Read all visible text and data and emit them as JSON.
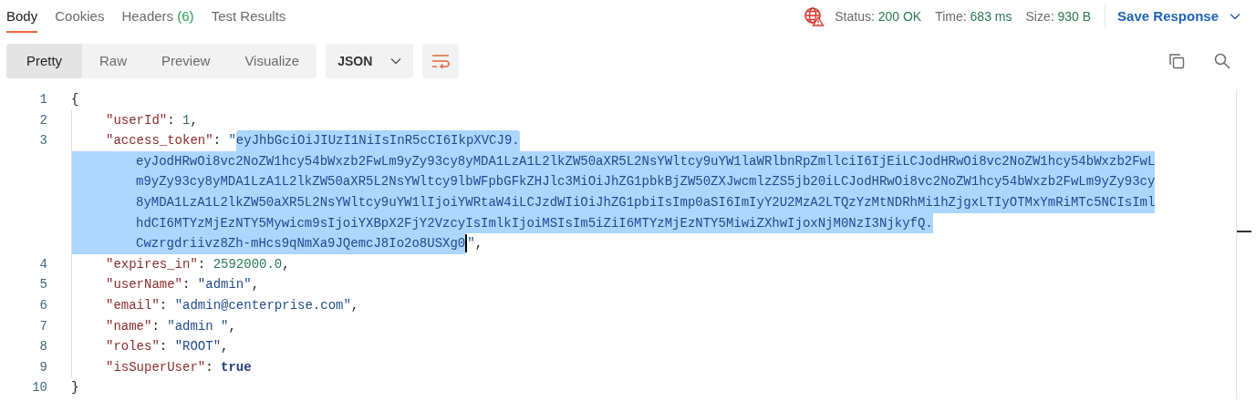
{
  "tabs": [
    {
      "label": "Body",
      "selected": true
    },
    {
      "label": "Cookies",
      "selected": false
    },
    {
      "label": "Headers",
      "count": "(6)",
      "selected": false
    },
    {
      "label": "Test Results",
      "selected": false
    }
  ],
  "status": [
    {
      "label": "Status:",
      "value": "200 OK"
    },
    {
      "label": "Time:",
      "value": "683 ms"
    },
    {
      "label": "Size:",
      "value": "930 B"
    }
  ],
  "save_response": "Save Response",
  "views": [
    {
      "label": "Pretty",
      "selected": true
    },
    {
      "label": "Raw",
      "selected": false
    },
    {
      "label": "Preview",
      "selected": false
    },
    {
      "label": "Visualize",
      "selected": false
    }
  ],
  "format": "JSON",
  "lines": [
    {
      "number": "1",
      "tokens": [
        {
          "kind": "punct",
          "text": "{"
        }
      ]
    },
    {
      "number": "2",
      "tokens": [
        {
          "kind": "key",
          "text": "\"userId\""
        },
        {
          "kind": "punct",
          "text": ": "
        },
        {
          "kind": "number",
          "text": "1"
        },
        {
          "kind": "punct",
          "text": ","
        }
      ]
    },
    {
      "number": "3",
      "tokens": [
        {
          "kind": "key",
          "text": "\"access_token\""
        },
        {
          "kind": "punct",
          "text": ": "
        },
        {
          "kind": "string",
          "text": "\""
        }
      ],
      "selection": {
        "selected": true,
        "lines": [
          "eyJhbGciOiJIUzI1NiIsInR5cCI6IkpXVCJ9.",
          "eyJodHRwOi8vc2NoZW1hcy54bWxzb2FwLm9yZy93cy8yMDA1LzA1L2lkZW50aXR5L2NsYWltcy9uYW1laWRlbnRpZmllciI6IjEiLCJodHRwOi8vc2NoZW1hcy54bWxzb2FwL",
          "m9yZy93cy8yMDA1LzA1L2lkZW50aXR5L2NsYWltcy9lbWFpbGFkZHJlc3MiOiJhZG1pbkBjZW50ZXJwcmlzZS5jb20iLCJodHRwOi8vc2NoZW1hcy54bWxzb2FwLm9yZy93cy",
          "8yMDA1LzA1L2lkZW50aXR5L2NsYWltcy9uYW1lIjoiYWRtaW4iLCJzdWIiOiJhZG1pbiIsImp0aSI6ImIyY2U2MzA2LTQzYzMtNDRhMi1hZjgxLTIyOTMxYmRiMTc5NCIsIml",
          "hdCI6MTYzMjEzNTY5Mywicm9sIjoiYXBpX2FjY2VzcyIsImlkIjoiMSIsIm5iZiI6MTYzMjEzNTY5MiwiZXhwIjoxNjM0NzI3NjkyfQ.",
          "Cwzrgdriivz8Zh-mHcs9qNmXa9JQemcJ8Io2o8USXg0"
        ]
      },
      "after": [
        {
          "kind": "string",
          "text": "\""
        },
        {
          "kind": "punct",
          "text": ","
        }
      ]
    },
    {
      "number": "4",
      "tokens": [
        {
          "kind": "key",
          "text": "\"expires_in\""
        },
        {
          "kind": "punct",
          "text": ": "
        },
        {
          "kind": "number",
          "text": "2592000.0"
        },
        {
          "kind": "punct",
          "text": ","
        }
      ]
    },
    {
      "number": "5",
      "tokens": [
        {
          "kind": "key",
          "text": "\"userName\""
        },
        {
          "kind": "punct",
          "text": ": "
        },
        {
          "kind": "string",
          "text": "\"admin\""
        },
        {
          "kind": "punct",
          "text": ","
        }
      ]
    },
    {
      "number": "6",
      "tokens": [
        {
          "kind": "key",
          "text": "\"email\""
        },
        {
          "kind": "punct",
          "text": ": "
        },
        {
          "kind": "string",
          "text": "\"admin@centerprise.com\""
        },
        {
          "kind": "punct",
          "text": ","
        }
      ]
    },
    {
      "number": "7",
      "tokens": [
        {
          "kind": "key",
          "text": "\"name\""
        },
        {
          "kind": "punct",
          "text": ": "
        },
        {
          "kind": "string",
          "text": "\"admin \""
        },
        {
          "kind": "punct",
          "text": ","
        }
      ]
    },
    {
      "number": "8",
      "tokens": [
        {
          "kind": "key",
          "text": "\"roles\""
        },
        {
          "kind": "punct",
          "text": ": "
        },
        {
          "kind": "string",
          "text": "\"ROOT\""
        },
        {
          "kind": "punct",
          "text": ","
        }
      ]
    },
    {
      "number": "9",
      "tokens": [
        {
          "kind": "key",
          "text": "\"isSuperUser\""
        },
        {
          "kind": "punct",
          "text": ": "
        },
        {
          "kind": "bool",
          "text": "true"
        }
      ]
    },
    {
      "number": "10",
      "tokens": [
        {
          "kind": "punct",
          "text": "}"
        }
      ]
    }
  ]
}
